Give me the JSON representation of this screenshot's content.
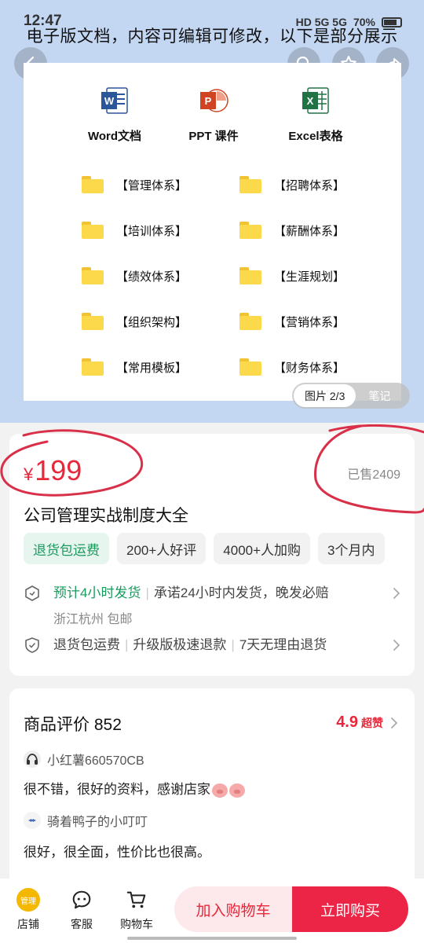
{
  "status": {
    "time": "12:47",
    "network": "HD 5G 5G",
    "battery": "70%"
  },
  "hero": {
    "caption": "电子版文档，内容可编辑可修改，以下是部分展示",
    "file_types": [
      {
        "label": "Word文档",
        "icon": "word-icon",
        "color": "#2b579a",
        "letter": "W"
      },
      {
        "label": "PPT 课件",
        "icon": "ppt-icon",
        "color": "#d04423",
        "letter": "P"
      },
      {
        "label": "Excel表格",
        "icon": "excel-icon",
        "color": "#217346",
        "letter": "X"
      }
    ],
    "folders": [
      "【管理体系】",
      "【招聘体系】",
      "【培训体系】",
      "【薪酬体系】",
      "【绩效体系】",
      "【生涯规划】",
      "【组织架构】",
      "【营销体系】",
      "【常用模板】",
      "【财务体系】"
    ],
    "page_indicator": "图片 2/3",
    "notes_label": "笔记"
  },
  "product": {
    "currency": "¥",
    "price": "199",
    "sold": "已售2409",
    "title": "公司管理实战制度大全",
    "tags": [
      "退货包运费",
      "200+人好评",
      "4000+人加购",
      "3个月内"
    ],
    "shipping": {
      "highlight": "预计4小时发货",
      "text": "承诺24小时内发货，晚发必赔",
      "origin": "浙江杭州 包邮"
    },
    "service": [
      "退货包运费",
      "升级版极速退款",
      "7天无理由退货"
    ]
  },
  "reviews": {
    "title": "商品评价 852",
    "score": "4.9",
    "score_word": "超赞",
    "items": [
      {
        "user": "小红薯660570CB",
        "text": "很不错，很好的资料，感谢店家"
      },
      {
        "user": "骑着鸭子的小叮叮",
        "text": "很好，很全面，性价比也很高。"
      }
    ]
  },
  "bottom_bar": {
    "shop_badge": "管理",
    "shop": "店铺",
    "service": "客服",
    "cart": "购物车",
    "add_to_cart": "加入购物车",
    "buy_now": "立即购买"
  },
  "colors": {
    "accent": "#e8273a",
    "green": "#1a9a5f",
    "hero_bg": "#c3d7f3"
  }
}
